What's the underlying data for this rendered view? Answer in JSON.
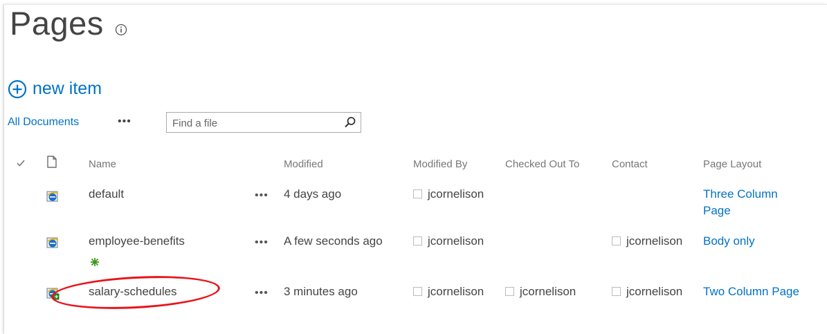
{
  "page": {
    "title": "Pages"
  },
  "toolbar": {
    "new_item_label": "new item",
    "view_label": "All Documents",
    "more_label": "•••"
  },
  "search": {
    "placeholder": "Find a file"
  },
  "columns": {
    "name": "Name",
    "modified": "Modified",
    "modified_by": "Modified By",
    "checked_out_to": "Checked Out To",
    "contact": "Contact",
    "page_layout": "Page Layout"
  },
  "rows": [
    {
      "name": "default",
      "modified": "4 days ago",
      "modified_by": "jcornelison",
      "checked_out_to": "",
      "contact": "",
      "layout_line1": "Three Column",
      "layout_line2": "Page",
      "new": false,
      "checked_out": false
    },
    {
      "name": "employee-benefits",
      "modified": "A few seconds ago",
      "modified_by": "jcornelison",
      "checked_out_to": "",
      "contact": "jcornelison",
      "layout_line1": "Body only",
      "layout_line2": "",
      "new": true,
      "new_icon": "new-sparkle-icon",
      "checked_out": false
    },
    {
      "name": "salary-schedules",
      "modified": "3 minutes ago",
      "modified_by": "jcornelison",
      "checked_out_to": "jcornelison",
      "contact": "jcornelison",
      "layout_line1": "Two Column Page",
      "layout_line2": "",
      "new": false,
      "checked_out": true,
      "highlighted": true
    }
  ],
  "colors": {
    "link": "#0072c6",
    "highlight": "#e8141b",
    "new_icon": "#3a9a1a"
  }
}
